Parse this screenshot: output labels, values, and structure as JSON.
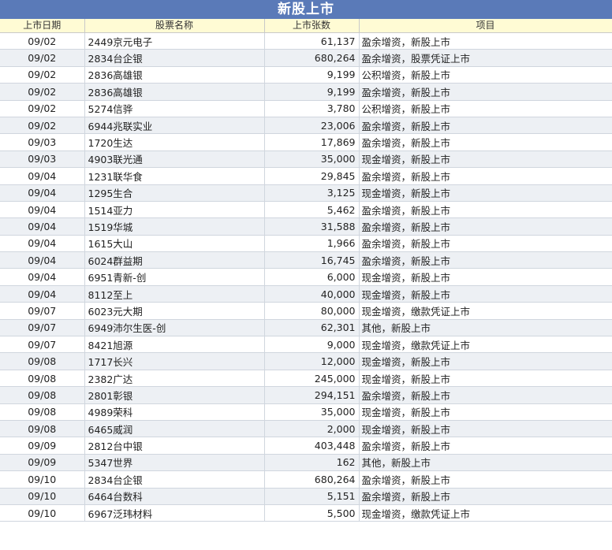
{
  "title": "新股上市",
  "columns": [
    "上市日期",
    "股票名称",
    "上市张数",
    "项目"
  ],
  "rows": [
    {
      "date": "09/02",
      "name": "2449京元电子",
      "volume": "61,137",
      "item": "盈余增资，新股上市"
    },
    {
      "date": "09/02",
      "name": "2834台企银",
      "volume": "680,264",
      "item": "盈余增资，股票凭证上市"
    },
    {
      "date": "09/02",
      "name": "2836高雄银",
      "volume": "9,199",
      "item": "公积增资，新股上市"
    },
    {
      "date": "09/02",
      "name": "2836高雄银",
      "volume": "9,199",
      "item": "盈余增资，新股上市"
    },
    {
      "date": "09/02",
      "name": "5274信骅",
      "volume": "3,780",
      "item": "公积增资，新股上市"
    },
    {
      "date": "09/02",
      "name": "6944兆联实业",
      "volume": "23,006",
      "item": "盈余增资，新股上市"
    },
    {
      "date": "09/03",
      "name": "1720生达",
      "volume": "17,869",
      "item": "盈余增资，新股上市"
    },
    {
      "date": "09/03",
      "name": "4903联光通",
      "volume": "35,000",
      "item": "现金增资，新股上市"
    },
    {
      "date": "09/04",
      "name": "1231联华食",
      "volume": "29,845",
      "item": "盈余增资，新股上市"
    },
    {
      "date": "09/04",
      "name": "1295生合",
      "volume": "3,125",
      "item": "现金增资，新股上市"
    },
    {
      "date": "09/04",
      "name": "1514亚力",
      "volume": "5,462",
      "item": "盈余增资，新股上市"
    },
    {
      "date": "09/04",
      "name": "1519华城",
      "volume": "31,588",
      "item": "盈余增资，新股上市"
    },
    {
      "date": "09/04",
      "name": "1615大山",
      "volume": "1,966",
      "item": "盈余增资，新股上市"
    },
    {
      "date": "09/04",
      "name": "6024群益期",
      "volume": "16,745",
      "item": "盈余增资，新股上市"
    },
    {
      "date": "09/04",
      "name": "6951青新-创",
      "volume": "6,000",
      "item": "现金增资，新股上市"
    },
    {
      "date": "09/04",
      "name": "8112至上",
      "volume": "40,000",
      "item": "现金增资，新股上市"
    },
    {
      "date": "09/07",
      "name": "6023元大期",
      "volume": "80,000",
      "item": "现金增资，缴款凭证上市"
    },
    {
      "date": "09/07",
      "name": "6949沛尔生医-创",
      "volume": "62,301",
      "item": "其他，新股上市"
    },
    {
      "date": "09/07",
      "name": "8421旭源",
      "volume": "9,000",
      "item": "现金增资，缴款凭证上市"
    },
    {
      "date": "09/08",
      "name": "1717长兴",
      "volume": "12,000",
      "item": "现金增资，新股上市"
    },
    {
      "date": "09/08",
      "name": "2382广达",
      "volume": "245,000",
      "item": "现金增资，新股上市"
    },
    {
      "date": "09/08",
      "name": "2801彰银",
      "volume": "294,151",
      "item": "盈余增资，新股上市"
    },
    {
      "date": "09/08",
      "name": "4989荣科",
      "volume": "35,000",
      "item": "现金增资，新股上市"
    },
    {
      "date": "09/08",
      "name": "6465威润",
      "volume": "2,000",
      "item": "现金增资，新股上市"
    },
    {
      "date": "09/09",
      "name": "2812台中银",
      "volume": "403,448",
      "item": "盈余增资，新股上市"
    },
    {
      "date": "09/09",
      "name": "5347世界",
      "volume": "162",
      "item": "其他，新股上市"
    },
    {
      "date": "09/10",
      "name": "2834台企银",
      "volume": "680,264",
      "item": "盈余增资，新股上市"
    },
    {
      "date": "09/10",
      "name": "6464台数科",
      "volume": "5,151",
      "item": "盈余增资，新股上市"
    },
    {
      "date": "09/10",
      "name": "6967泛玮材料",
      "volume": "5,500",
      "item": "现金增资，缴款凭证上市"
    }
  ],
  "colors": {
    "title_bg": "#5a7ab8",
    "header_bg": "#fffbd4",
    "stripe_bg": "#edf0f4"
  }
}
